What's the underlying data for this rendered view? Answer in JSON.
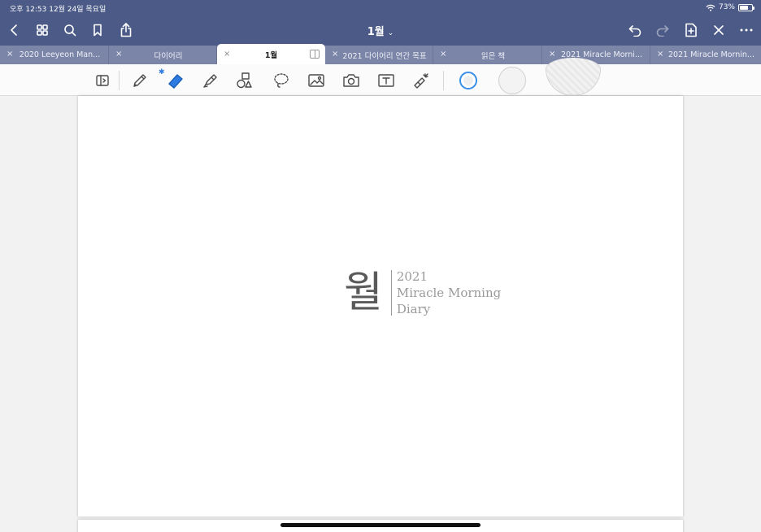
{
  "status": {
    "time_date": "오후 12:53   12월 24일 목요일",
    "battery": "73%",
    "battery_level": 0.73
  },
  "nav": {
    "title": "1월",
    "title_chevron": "⌄"
  },
  "tabs": [
    {
      "label": "2020 Leeyeon Man...",
      "active": false
    },
    {
      "label": "다이어리",
      "active": false
    },
    {
      "label": "1월",
      "active": true
    },
    {
      "label": "2021 다이어리 연간 목표",
      "active": false
    },
    {
      "label": "읽은 책",
      "active": false
    },
    {
      "label": "2021 Miracle Morni...",
      "active": false
    },
    {
      "label": "2021 Miracle Mornin...",
      "active": false
    }
  ],
  "toolbar": {
    "bluetooth": "✱",
    "accent": "#2d7be0"
  },
  "page": {
    "logo_char": "월",
    "year": "2021",
    "line2": "Miracle Morning",
    "line3": "Diary"
  },
  "colors": {
    "nav_bg": "#4b5a86",
    "tab_bg": "#7b85a8",
    "toolbar_bg": "#fbfbfb"
  }
}
